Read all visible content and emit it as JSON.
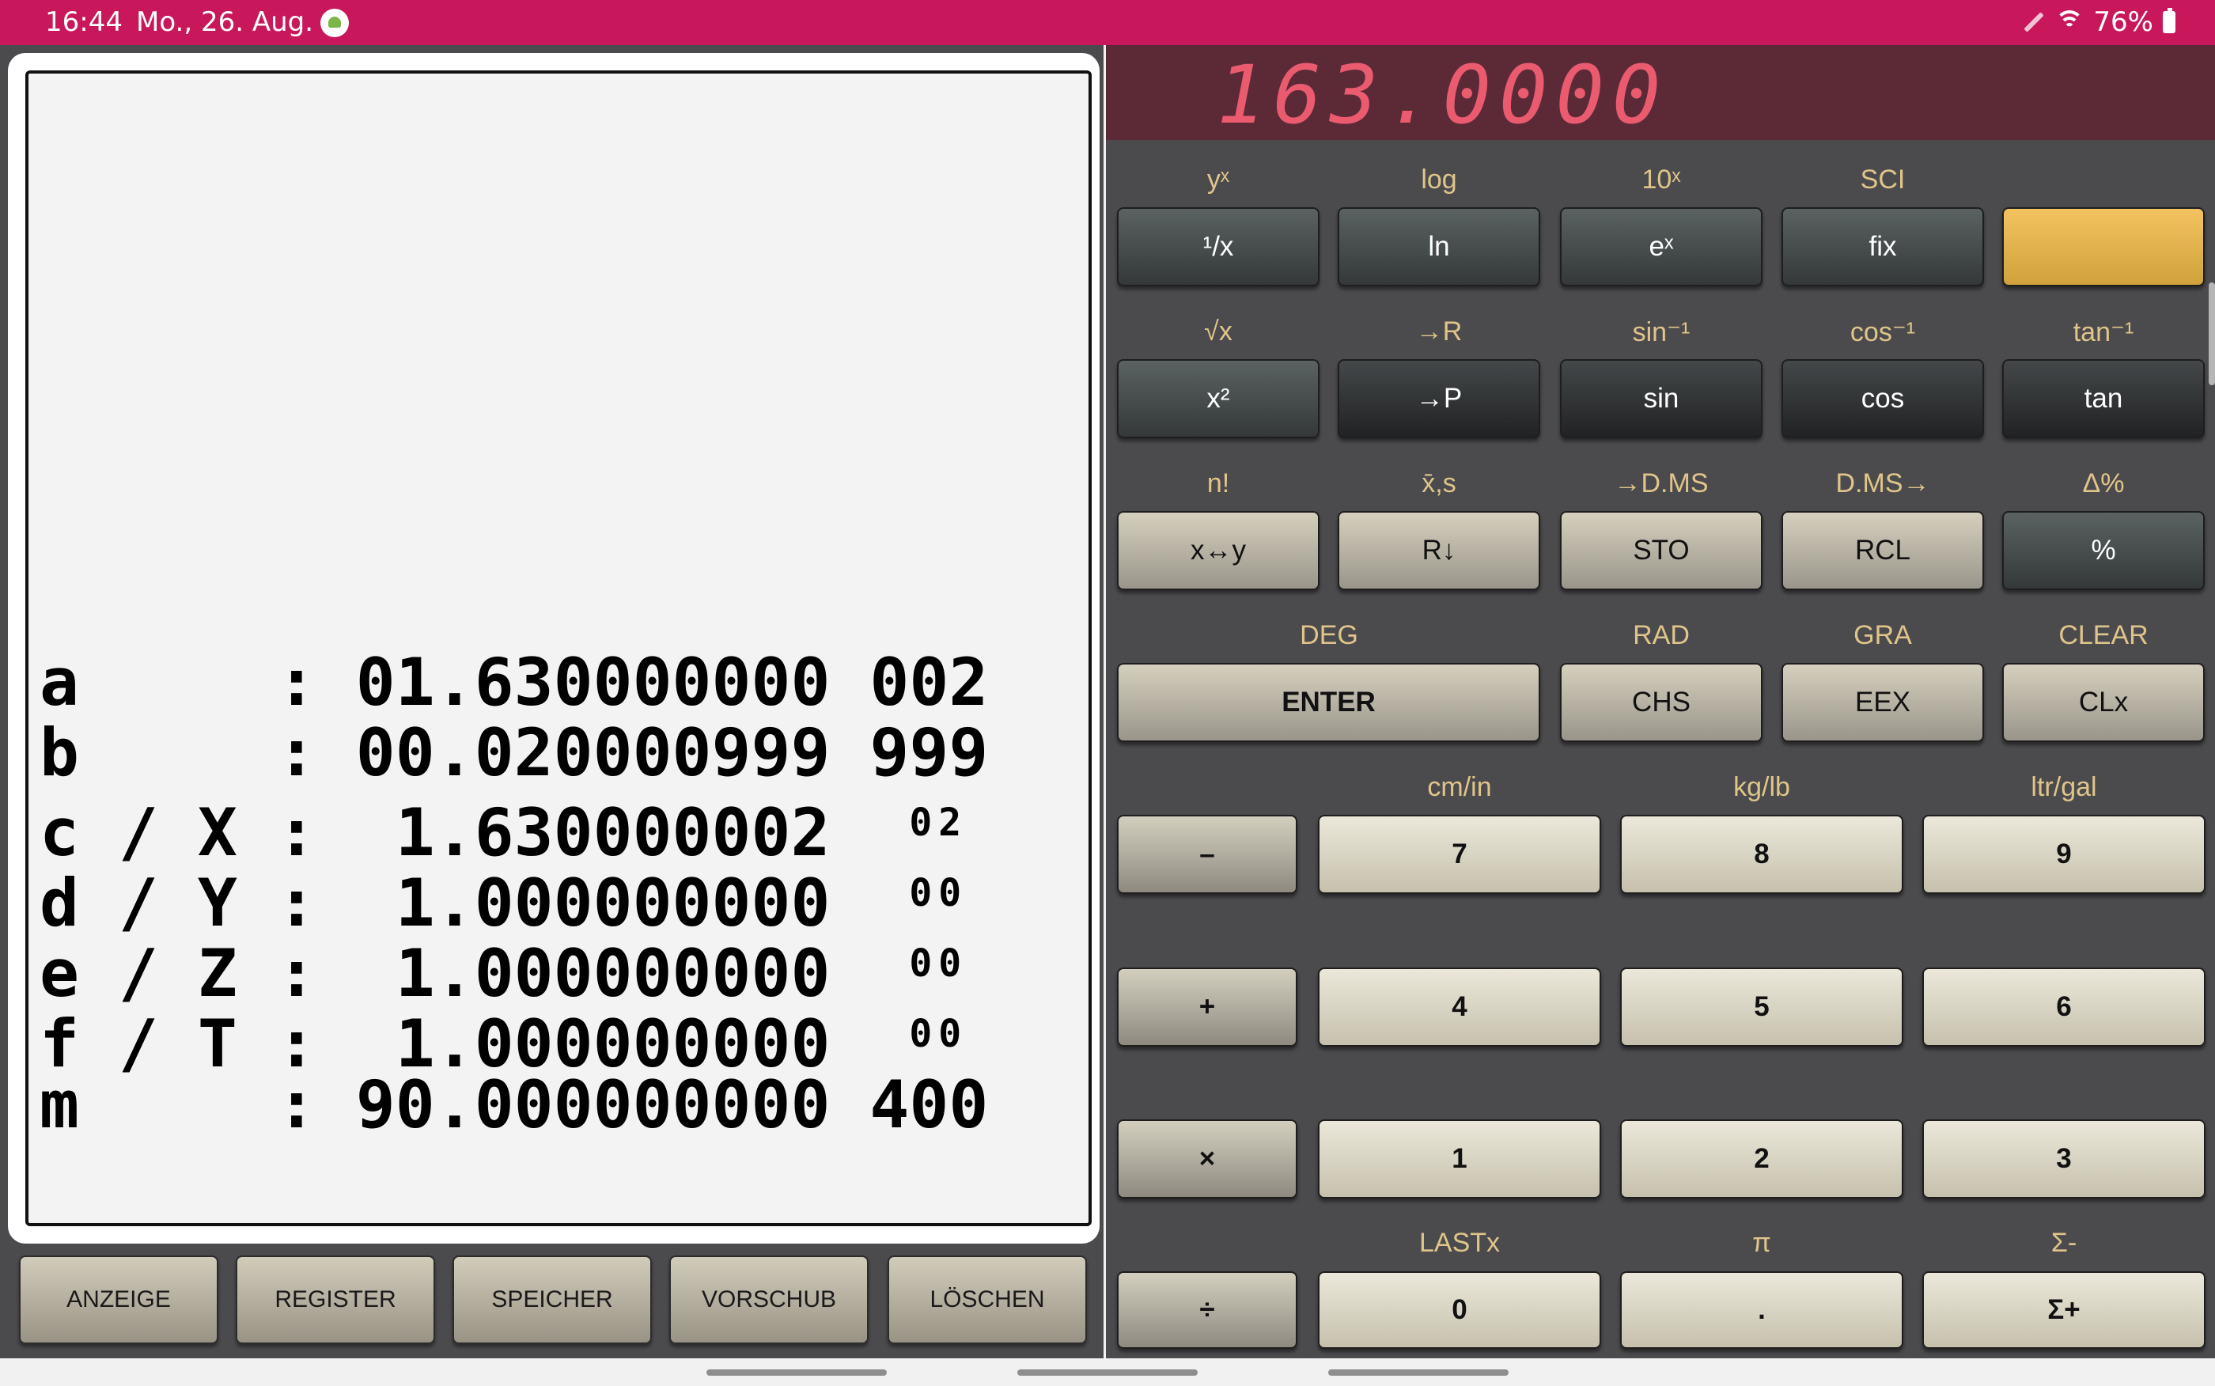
{
  "status_bar": {
    "time": "16:44",
    "date": "Mo., 26. Aug.",
    "battery": "76%"
  },
  "display": {
    "value": "163.0000"
  },
  "printer": {
    "lines": [
      {
        "reg": "a    ",
        "value": "01.630000000",
        "exp": "002",
        "small": false
      },
      {
        "reg": "b    ",
        "value": "00.020000999",
        "exp": "999",
        "small": false
      },
      {
        "reg": "c / X",
        "value": " 1.630000002",
        "exp": "02",
        "small": true
      },
      {
        "reg": "d / Y",
        "value": " 1.000000000",
        "exp": "00",
        "small": true
      },
      {
        "reg": "e / Z",
        "value": " 1.000000000",
        "exp": "00",
        "small": true
      },
      {
        "reg": "f / T",
        "value": " 1.000000000",
        "exp": "00",
        "small": true
      },
      {
        "reg": "m    ",
        "value": "90.000000000",
        "exp": "400",
        "small": false
      }
    ],
    "buttons": [
      "ANZEIGE",
      "REGISTER",
      "SPEICHER",
      "VORSCHUB",
      "LÖSCHEN"
    ]
  },
  "calculator": {
    "row1": {
      "shift": [
        "yˣ",
        "log",
        "10ˣ",
        "SCI",
        ""
      ],
      "keys": [
        "¹/x",
        "ln",
        "eˣ",
        "fix",
        ""
      ]
    },
    "row2": {
      "shift": [
        "√x",
        "→R",
        "sin⁻¹",
        "cos⁻¹",
        "tan⁻¹"
      ],
      "keys": [
        "x²",
        "→P",
        "sin",
        "cos",
        "tan"
      ]
    },
    "row3": {
      "shift": [
        "n!",
        "x̄,s",
        "→D.MS",
        "D.MS→",
        "Δ%"
      ],
      "keys": [
        "x↔y",
        "R↓",
        "STO",
        "RCL",
        "%"
      ]
    },
    "row4": {
      "shift": [
        "DEG",
        "RAD",
        "GRA",
        "CLEAR"
      ],
      "keys": [
        "ENTER",
        "CHS",
        "EEX",
        "CLx"
      ]
    },
    "row5": {
      "shift": [
        "cm/in",
        "kg/lb",
        "ltr/gal"
      ],
      "keys": [
        "–",
        "7",
        "8",
        "9"
      ]
    },
    "row6": {
      "keys": [
        "+",
        "4",
        "5",
        "6"
      ]
    },
    "row7": {
      "keys": [
        "×",
        "1",
        "2",
        "3"
      ]
    },
    "row8": {
      "shift": [
        "LASTx",
        "π",
        "Σ-"
      ],
      "keys": [
        "÷",
        "0",
        ".",
        "Σ+"
      ]
    }
  }
}
